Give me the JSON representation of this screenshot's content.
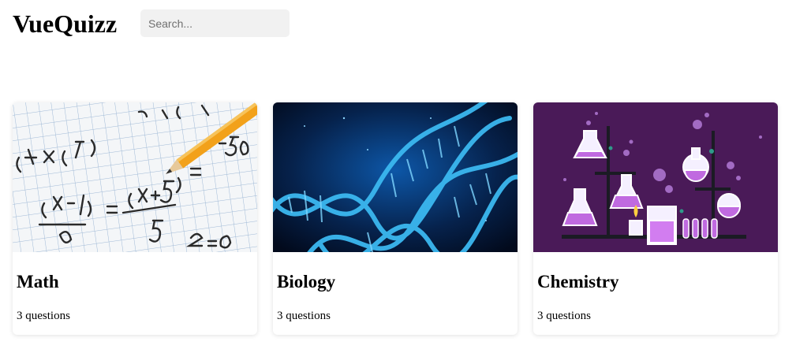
{
  "header": {
    "logo": "VueQuizz",
    "search_placeholder": "Search..."
  },
  "quizzes": [
    {
      "title": "Math",
      "count": "3 questions",
      "image": "math-notebook-image"
    },
    {
      "title": "Biology",
      "count": "3 questions",
      "image": "dna-helix-image"
    },
    {
      "title": "Chemistry",
      "count": "3 questions",
      "image": "lab-flasks-image"
    }
  ],
  "colors": {
    "search_bg": "#f1f1f1",
    "biology_bg": "#041a3d",
    "dna_blue": "#3bb8f0",
    "chemistry_bg": "#4a1a58",
    "flask_violet": "#c06ae0"
  }
}
